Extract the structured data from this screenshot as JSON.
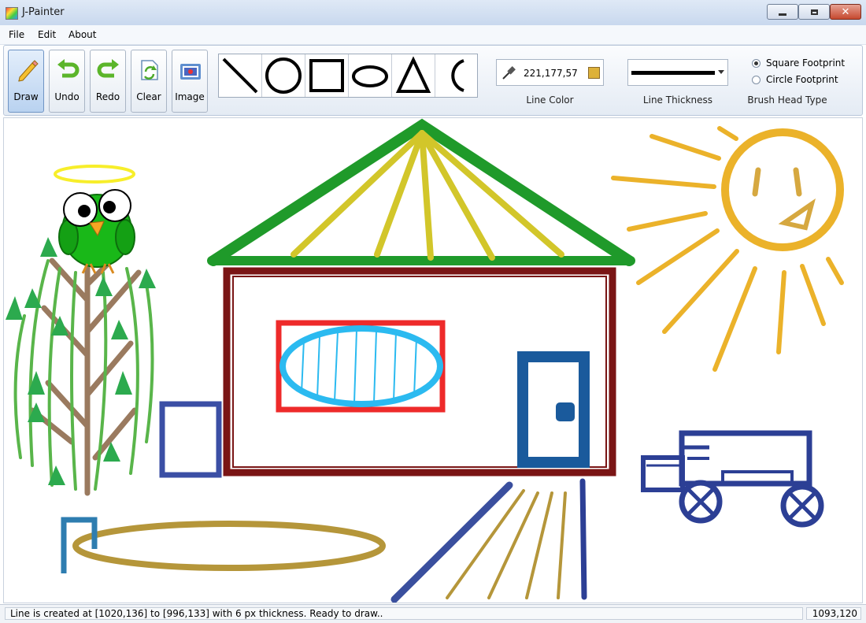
{
  "window": {
    "title": "J-Painter",
    "close_glyph": "✕"
  },
  "menu": {
    "items": [
      "File",
      "Edit",
      "About"
    ]
  },
  "toolbar": {
    "buttons": [
      {
        "label": "Draw",
        "icon": "pencil-icon",
        "active": true
      },
      {
        "label": "Undo",
        "icon": "undo-arrow-icon",
        "active": false
      },
      {
        "label": "Redo",
        "icon": "redo-arrow-icon",
        "active": false
      },
      {
        "label": "Clear",
        "icon": "clear-refresh-icon",
        "active": false
      },
      {
        "label": "Image",
        "icon": "image-folder-icon",
        "active": false
      }
    ],
    "shapes": [
      "line",
      "circle",
      "rectangle",
      "ellipse",
      "triangle",
      "arc"
    ],
    "line_color": {
      "value": "221,177,57",
      "swatch": "#ddb139",
      "caption": "Line Color"
    },
    "line_thickness": {
      "caption": "Line Thickness"
    },
    "brush_head": {
      "caption": "Brush Head Type",
      "options": [
        {
          "label": "Square Footprint",
          "selected": true
        },
        {
          "label": "Circle Footprint",
          "selected": false
        }
      ]
    }
  },
  "status": {
    "message": "Line is created at [1020,136] to [996,133] with 6 px thickness. Ready to draw..",
    "coords": "1093,120"
  },
  "colors": {
    "roof": "#1f9a2a",
    "rays": "#d2c62a",
    "house": "#7a1515",
    "window": "#ee2a2a",
    "oval": "#2bbaf0",
    "door": "#1a5a9c",
    "sun": "#ebb22a",
    "truck": "#2c3f95",
    "ground_oval": "#b5963a",
    "tree_trunk": "#9a7a5f",
    "tree_vine": "#59b54a",
    "leaf": "#2caa4e"
  }
}
